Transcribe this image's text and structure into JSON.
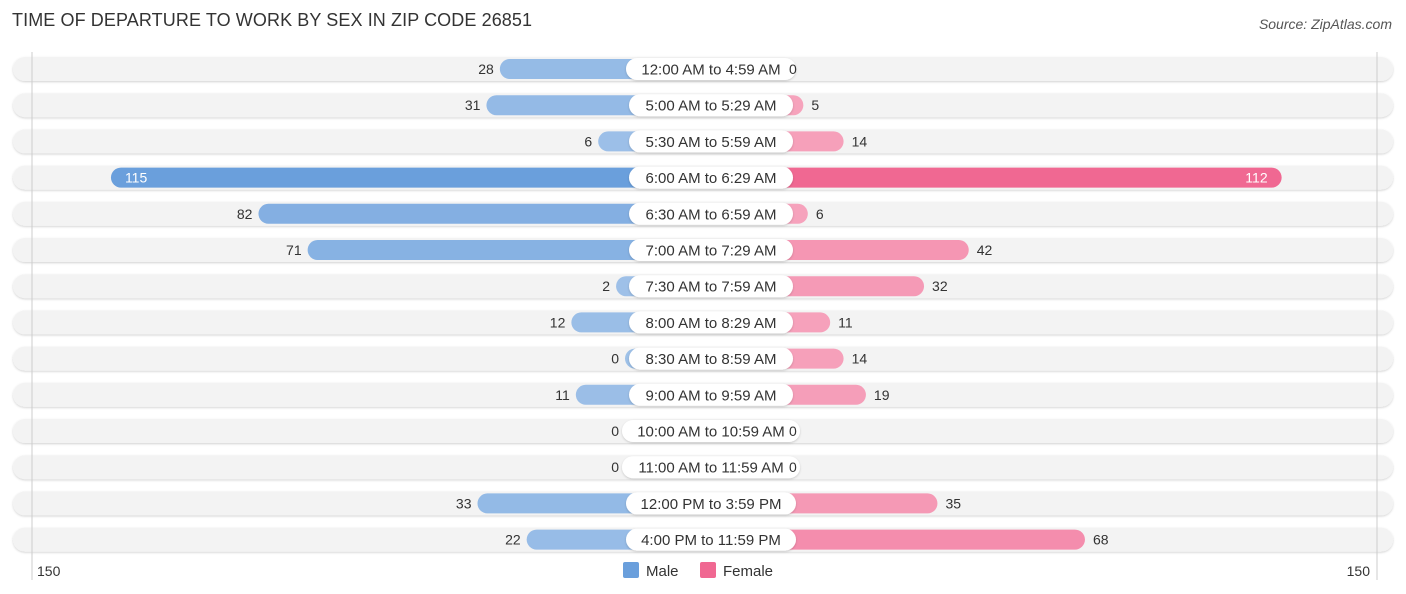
{
  "chart_data": {
    "type": "bar",
    "orientation": "horizontal-diverging",
    "title": "TIME OF DEPARTURE TO WORK BY SEX IN ZIP CODE 26851",
    "source": "Source: ZipAtlas.com",
    "categories": [
      "12:00 AM to 4:59 AM",
      "5:00 AM to 5:29 AM",
      "5:30 AM to 5:59 AM",
      "6:00 AM to 6:29 AM",
      "6:30 AM to 6:59 AM",
      "7:00 AM to 7:29 AM",
      "7:30 AM to 7:59 AM",
      "8:00 AM to 8:29 AM",
      "8:30 AM to 8:59 AM",
      "9:00 AM to 9:59 AM",
      "10:00 AM to 10:59 AM",
      "11:00 AM to 11:59 AM",
      "12:00 PM to 3:59 PM",
      "4:00 PM to 11:59 PM"
    ],
    "series": [
      {
        "name": "Male",
        "color": "#6a9fdc",
        "values": [
          28,
          31,
          6,
          115,
          82,
          71,
          2,
          12,
          0,
          11,
          0,
          0,
          33,
          22
        ]
      },
      {
        "name": "Female",
        "color": "#f06892",
        "values": [
          0,
          5,
          14,
          112,
          6,
          42,
          32,
          11,
          14,
          19,
          0,
          0,
          35,
          68
        ]
      }
    ],
    "axis": {
      "left_label": "150",
      "right_label": "150",
      "max": 150
    },
    "legend": {
      "position": "bottom-center",
      "items": [
        "Male",
        "Female"
      ]
    }
  }
}
